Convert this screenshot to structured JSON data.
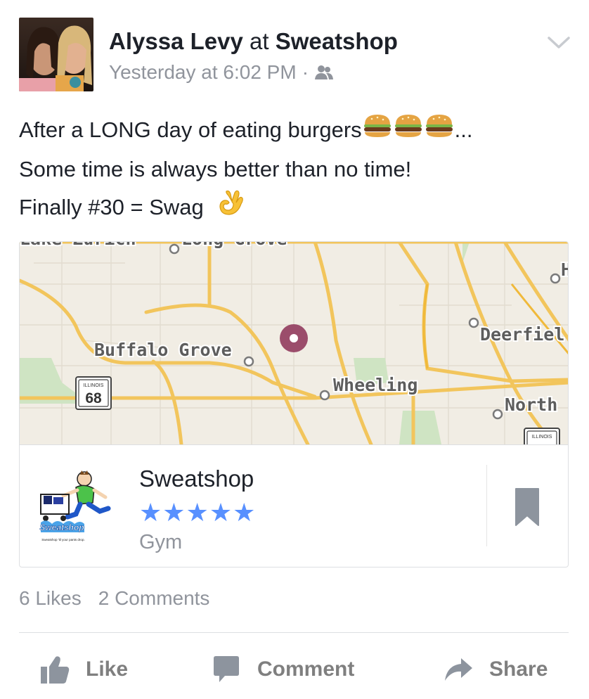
{
  "post": {
    "author": "Alyssa Levy",
    "at_word": "at",
    "place": "Sweatshop",
    "timestamp": "Yesterday at 6:02 PM",
    "separator": "·",
    "audience_icon": "friends-icon",
    "menu_icon": "chevron-down-icon",
    "text_lines": [
      "After a LONG day of eating burgers",
      "...",
      "Some time is always better than no time!",
      "Finally #30 = Swag"
    ],
    "emojis": [
      "hamburger-emoji",
      "ok-hand-emoji"
    ]
  },
  "map": {
    "labels": {
      "buffalo_grove": "Buffalo Grove",
      "wheeling": "Wheeling",
      "deerfield": "Deerfiel",
      "north": "North",
      "h_label": "H",
      "lake_zurich": "Lake Zurich",
      "long_grove": "Long Grove"
    },
    "shield_state": "ILLINOIS",
    "shield_number": "68",
    "shield2_state": "ILLINOIS",
    "pin_color": "#9b4d6b"
  },
  "place_card": {
    "name": "Sweatshop",
    "stars": "★★★★★",
    "category": "Gym",
    "logo_text": "Sweatshop",
    "logo_tagline": "Sweatshop 'til your pants drop.",
    "save_icon": "bookmark-icon"
  },
  "engagement": {
    "likes": "6 Likes",
    "comments": "2 Comments"
  },
  "actions": {
    "like": "Like",
    "comment": "Comment",
    "share": "Share"
  },
  "colors": {
    "text": "#1d2129",
    "secondary": "#90949c",
    "star_blue": "#5890ff",
    "action_grey": "#7f7f7f"
  }
}
